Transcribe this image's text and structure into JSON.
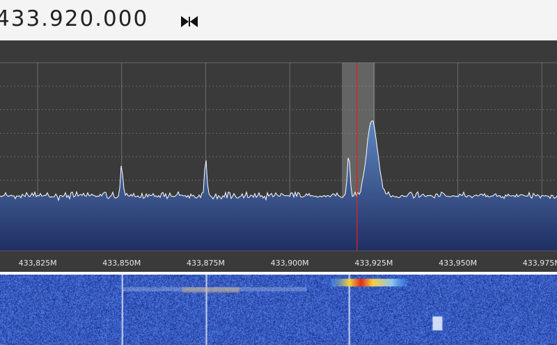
{
  "receiver": {
    "frequency_display": "433.920.000",
    "peak_hold_icon": "bowtie-icon"
  },
  "colors": {
    "panel_bg": "#3a3a3a",
    "grid": "#7a7a7a",
    "trace": "#ffffff",
    "fill_top": "#5f86bf",
    "fill_bottom": "#1f2f63",
    "tuning_line": "#e02020",
    "filter_band": "#9a9a9a",
    "waterfall_bg": "#1f3e9a"
  },
  "chart_data": {
    "type": "area",
    "x_axis_ticks": [
      "433,825M",
      "433,850M",
      "433,875M",
      "433,900M",
      "433,925M",
      "433,950M",
      "433,975M"
    ],
    "x_tick_values_mhz": [
      433.825,
      433.85,
      433.875,
      433.9,
      433.925,
      433.95,
      433.975
    ],
    "xlim_mhz": [
      433.8138,
      433.9795
    ],
    "tuned_frequency_mhz": 433.92,
    "filter_band_mhz": [
      433.9155,
      433.9253
    ],
    "peaks_mhz": [
      {
        "freq": 433.85,
        "level": 0.45
      },
      {
        "freq": 433.875,
        "level": 0.48
      },
      {
        "freq": 433.9175,
        "level": 0.52
      },
      {
        "freq": 433.9245,
        "level": 0.7
      }
    ],
    "noise_floor_level": 0.28,
    "grid": true
  }
}
